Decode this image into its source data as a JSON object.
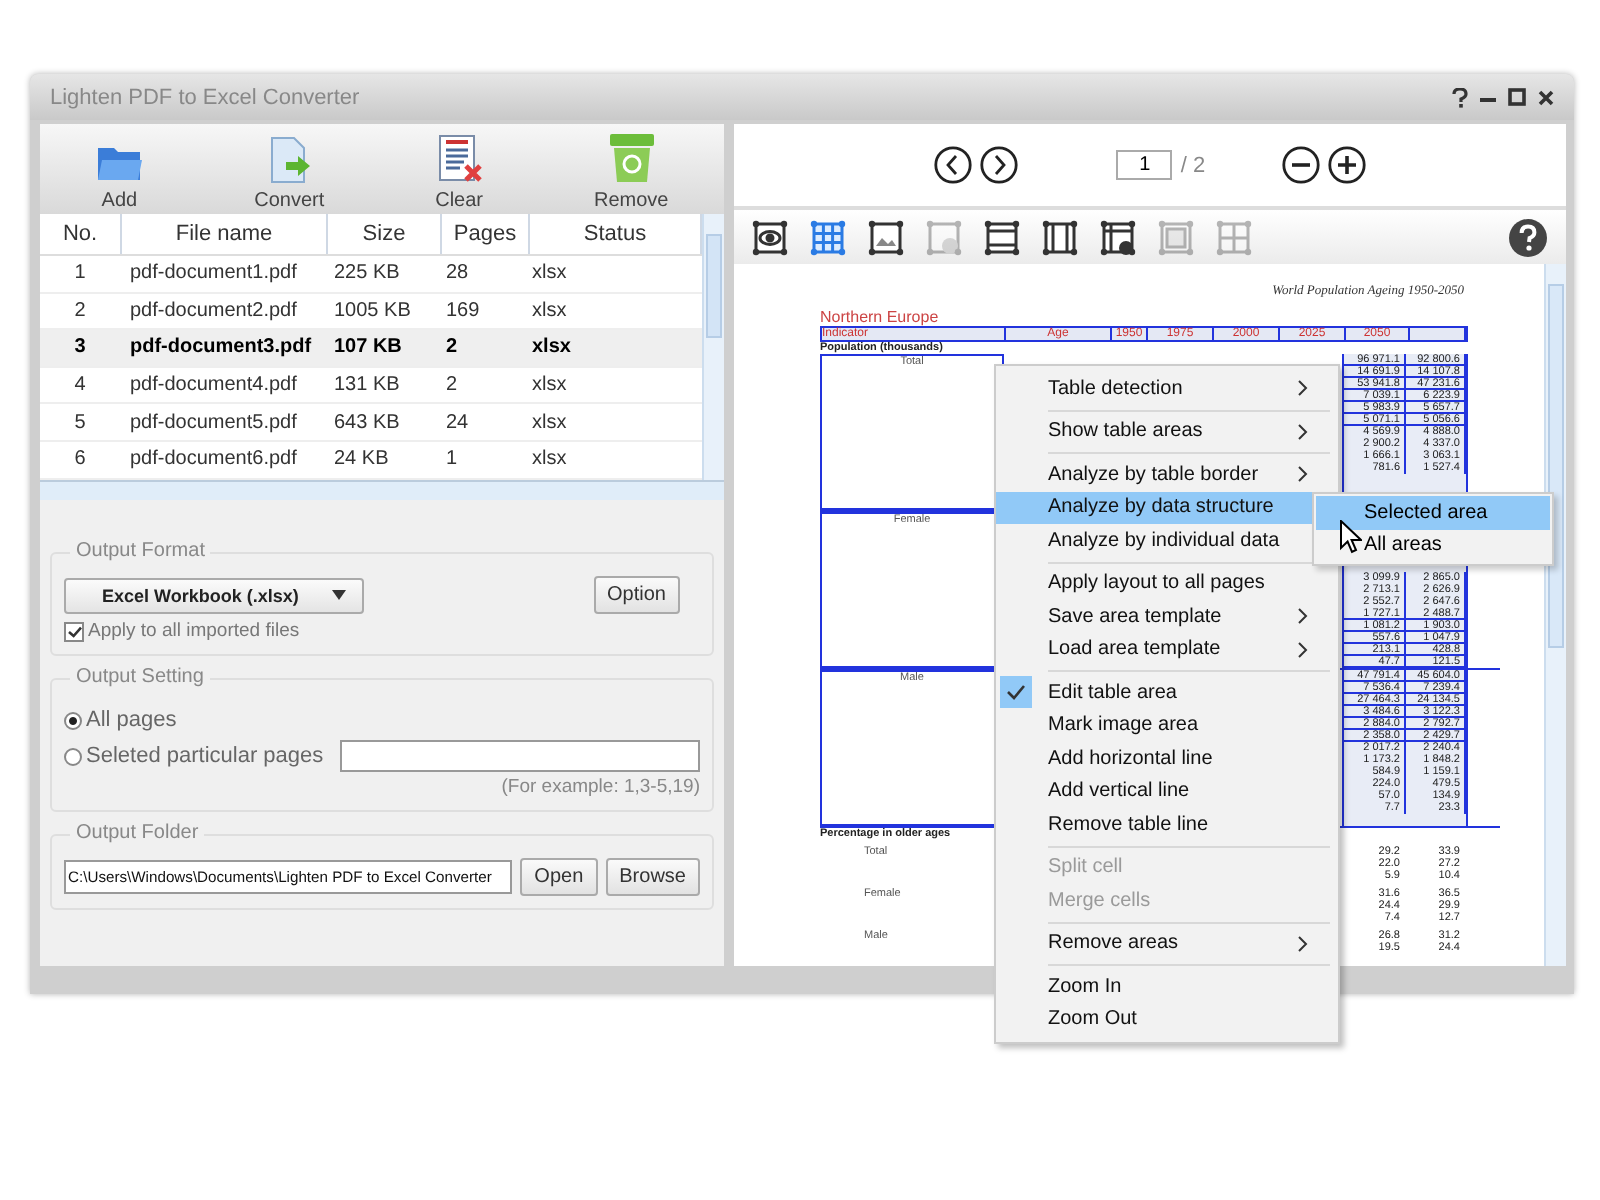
{
  "window": {
    "title": "Lighten PDF to Excel Converter"
  },
  "toolbar": [
    {
      "kind": "add",
      "label": "Add"
    },
    {
      "kind": "convert",
      "label": "Convert"
    },
    {
      "kind": "clear",
      "label": "Clear"
    },
    {
      "kind": "remove",
      "label": "Remove"
    }
  ],
  "file_table": {
    "columns": [
      "No.",
      "File name",
      "Size",
      "Pages",
      "Status"
    ],
    "rows": [
      {
        "no": "1",
        "file_name": "pdf-document1.pdf",
        "size": "225 KB",
        "pages": "28",
        "status": "xlsx",
        "selected": false
      },
      {
        "no": "2",
        "file_name": "pdf-document2.pdf",
        "size": "1005 KB",
        "pages": "169",
        "status": "xlsx",
        "selected": false
      },
      {
        "no": "3",
        "file_name": "pdf-document3.pdf",
        "size": "107 KB",
        "pages": "2",
        "status": "xlsx",
        "selected": true
      },
      {
        "no": "4",
        "file_name": "pdf-document4.pdf",
        "size": "131 KB",
        "pages": "2",
        "status": "xlsx",
        "selected": false
      },
      {
        "no": "5",
        "file_name": "pdf-document5.pdf",
        "size": "643 KB",
        "pages": "24",
        "status": "xlsx",
        "selected": false
      },
      {
        "no": "6",
        "file_name": "pdf-document6.pdf",
        "size": "24 KB",
        "pages": "1",
        "status": "xlsx",
        "selected": false
      }
    ]
  },
  "output_format": {
    "title": "Output Format",
    "format": "Excel Workbook (.xlsx)",
    "option_button": "Option",
    "apply_all": {
      "label": "Apply to all imported files",
      "checked": true
    }
  },
  "output_setting": {
    "title": "Output Setting",
    "options": [
      {
        "label": "All pages",
        "selected": true
      },
      {
        "label": "Seleted particular pages",
        "selected": false
      }
    ],
    "hint": "(For example: 1,3-5,19)"
  },
  "output_folder": {
    "title": "Output Folder",
    "path": "C:\\Users\\Windows\\Documents\\Lighten PDF to Excel Converter",
    "buttons": [
      "Open",
      "Browse"
    ]
  },
  "viewer": {
    "page": "1",
    "page_total": "/ 2",
    "tools": [
      {
        "kind": "view",
        "selected": false,
        "disabled": false
      },
      {
        "kind": "table",
        "selected": true,
        "disabled": false
      },
      {
        "kind": "image",
        "selected": false,
        "disabled": false
      },
      {
        "kind": "remove-area",
        "selected": false,
        "disabled": true
      },
      {
        "kind": "row",
        "selected": false,
        "disabled": false
      },
      {
        "kind": "column",
        "selected": false,
        "disabled": false
      },
      {
        "kind": "remove-line",
        "selected": false,
        "disabled": false
      },
      {
        "kind": "merge",
        "selected": false,
        "disabled": true
      },
      {
        "kind": "split",
        "selected": false,
        "disabled": true
      }
    ]
  },
  "document": {
    "header": "World Population Ageing 1950-2050",
    "region": "Northern Europe",
    "columns": [
      "Indicator",
      "Age",
      "1950",
      "1975",
      "2000",
      "2025",
      "2050"
    ],
    "section": "Population (thousands)",
    "groups": [
      {
        "label": "Total",
        "rows": [
          [
            "96 971.1",
            "92 800.6"
          ],
          [
            "14 691.9",
            "14 107.8"
          ],
          [
            "53 941.8",
            "47 231.6"
          ],
          [
            "7 039.1",
            "6 223.9"
          ],
          [
            "5 983.9",
            "5 657.7"
          ],
          [
            "5 071.1",
            "5 056.6"
          ],
          [
            "4 569.9",
            "4 888.0"
          ],
          [
            "2 900.2",
            "4 337.0"
          ],
          [
            "1 666.1",
            "3 063.1"
          ],
          [
            "781.6",
            "1 527.4"
          ]
        ]
      },
      {
        "label": "Female",
        "rows": [
          [
            "3 099.9",
            "2 865.0"
          ],
          [
            "2 713.1",
            "2 626.9"
          ],
          [
            "2 552.7",
            "2 647.6"
          ],
          [
            "1 727.1",
            "2 488.7"
          ],
          [
            "1 081.2",
            "1 903.0"
          ],
          [
            "557.6",
            "1 047.9"
          ],
          [
            "213.1",
            "428.8"
          ],
          [
            "47.7",
            "121.5"
          ]
        ]
      },
      {
        "label": "Male",
        "rows": [
          [
            "47 791.4",
            "45 604.0"
          ],
          [
            "7 536.4",
            "7 239.4"
          ],
          [
            "27 464.3",
            "24 134.5"
          ],
          [
            "3 484.6",
            "3 122.3"
          ],
          [
            "2 884.0",
            "2 792.7"
          ],
          [
            "2 358.0",
            "2 429.7"
          ],
          [
            "2 017.2",
            "2 240.4"
          ],
          [
            "1 173.2",
            "1 848.2"
          ],
          [
            "584.9",
            "1 159.1"
          ],
          [
            "224.0",
            "479.5"
          ],
          [
            "57.0",
            "134.9"
          ],
          [
            "7.7",
            "23.3"
          ]
        ]
      }
    ],
    "section_2": "Percentage in older ages",
    "groups_2": [
      {
        "label": "Total",
        "rows": [
          [
            "29.2",
            "33.9"
          ],
          [
            "22.0",
            "27.2"
          ],
          [
            "5.9",
            "10.4"
          ]
        ]
      },
      {
        "label": "Female",
        "rows": [
          [
            "31.6",
            "36.5"
          ],
          [
            "24.4",
            "29.9"
          ],
          [
            "7.4",
            "12.7"
          ]
        ]
      },
      {
        "label": "Male",
        "rows": [
          [
            "26.8",
            "31.2"
          ],
          [
            "19.5",
            "24.4"
          ]
        ]
      }
    ]
  },
  "context_menu": {
    "groups": [
      [
        {
          "label": "Table detection",
          "submenu": true,
          "checked": false,
          "disabled": false,
          "selected": false
        }
      ],
      [
        {
          "label": "Show table areas",
          "submenu": true,
          "checked": false,
          "disabled": false,
          "selected": false
        }
      ],
      [
        {
          "label": "Analyze by table border",
          "submenu": true,
          "checked": false,
          "disabled": false,
          "selected": false
        },
        {
          "label": "Analyze by data structure",
          "submenu": false,
          "checked": false,
          "disabled": false,
          "selected": true
        },
        {
          "label": "Analyze by individual data",
          "submenu": false,
          "checked": false,
          "disabled": false,
          "selected": false
        }
      ],
      [
        {
          "label": "Apply layout to all pages",
          "submenu": false,
          "checked": false,
          "disabled": false,
          "selected": false
        },
        {
          "label": "Save area template",
          "submenu": true,
          "checked": false,
          "disabled": false,
          "selected": false
        },
        {
          "label": "Load area template",
          "submenu": true,
          "checked": false,
          "disabled": false,
          "selected": false
        }
      ],
      [
        {
          "label": "Edit table area",
          "submenu": false,
          "checked": true,
          "disabled": false,
          "selected": false
        },
        {
          "label": "Mark image area",
          "submenu": false,
          "checked": false,
          "disabled": false,
          "selected": false
        },
        {
          "label": "Add horizontal line",
          "submenu": false,
          "checked": false,
          "disabled": false,
          "selected": false
        },
        {
          "label": "Add vertical line",
          "submenu": false,
          "checked": false,
          "disabled": false,
          "selected": false
        },
        {
          "label": "Remove table line",
          "submenu": false,
          "checked": false,
          "disabled": false,
          "selected": false
        }
      ],
      [
        {
          "label": "Split cell",
          "submenu": false,
          "checked": false,
          "disabled": true,
          "selected": false
        },
        {
          "label": "Merge cells",
          "submenu": false,
          "checked": false,
          "disabled": true,
          "selected": false
        }
      ],
      [
        {
          "label": "Remove areas",
          "submenu": true,
          "checked": false,
          "disabled": false,
          "selected": false
        }
      ],
      [
        {
          "label": "Zoom In",
          "submenu": false,
          "checked": false,
          "disabled": false,
          "selected": false
        },
        {
          "label": "Zoom Out",
          "submenu": false,
          "checked": false,
          "disabled": false,
          "selected": false
        }
      ]
    ],
    "submenu": [
      {
        "label": "Selected area",
        "selected": true
      },
      {
        "label": "All areas",
        "selected": false
      }
    ]
  }
}
